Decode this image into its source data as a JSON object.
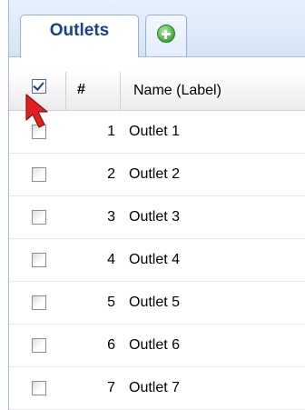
{
  "tabs": [
    {
      "label": "Outlets",
      "active": true
    },
    {
      "label": "",
      "icon": "add-icon"
    }
  ],
  "grid": {
    "columns": [
      {
        "key": "select",
        "label": "",
        "icon": "select-all-checkbox",
        "checked": true
      },
      {
        "key": "num",
        "label": "#"
      },
      {
        "key": "name",
        "label": "Name (Label)"
      }
    ],
    "rows": [
      {
        "num": "1",
        "name": "Outlet 1",
        "checked": false
      },
      {
        "num": "2",
        "name": "Outlet 2",
        "checked": false
      },
      {
        "num": "3",
        "name": "Outlet 3",
        "checked": false
      },
      {
        "num": "4",
        "name": "Outlet 4",
        "checked": false
      },
      {
        "num": "5",
        "name": "Outlet 5",
        "checked": false
      },
      {
        "num": "6",
        "name": "Outlet 6",
        "checked": false
      },
      {
        "num": "7",
        "name": "Outlet 7",
        "checked": false
      }
    ]
  },
  "annotation": {
    "icon": "red-pointer-arrow-icon",
    "color": "#e02020"
  },
  "colors": {
    "tab_text": "#15428b",
    "panel_border": "#99bbe8"
  }
}
